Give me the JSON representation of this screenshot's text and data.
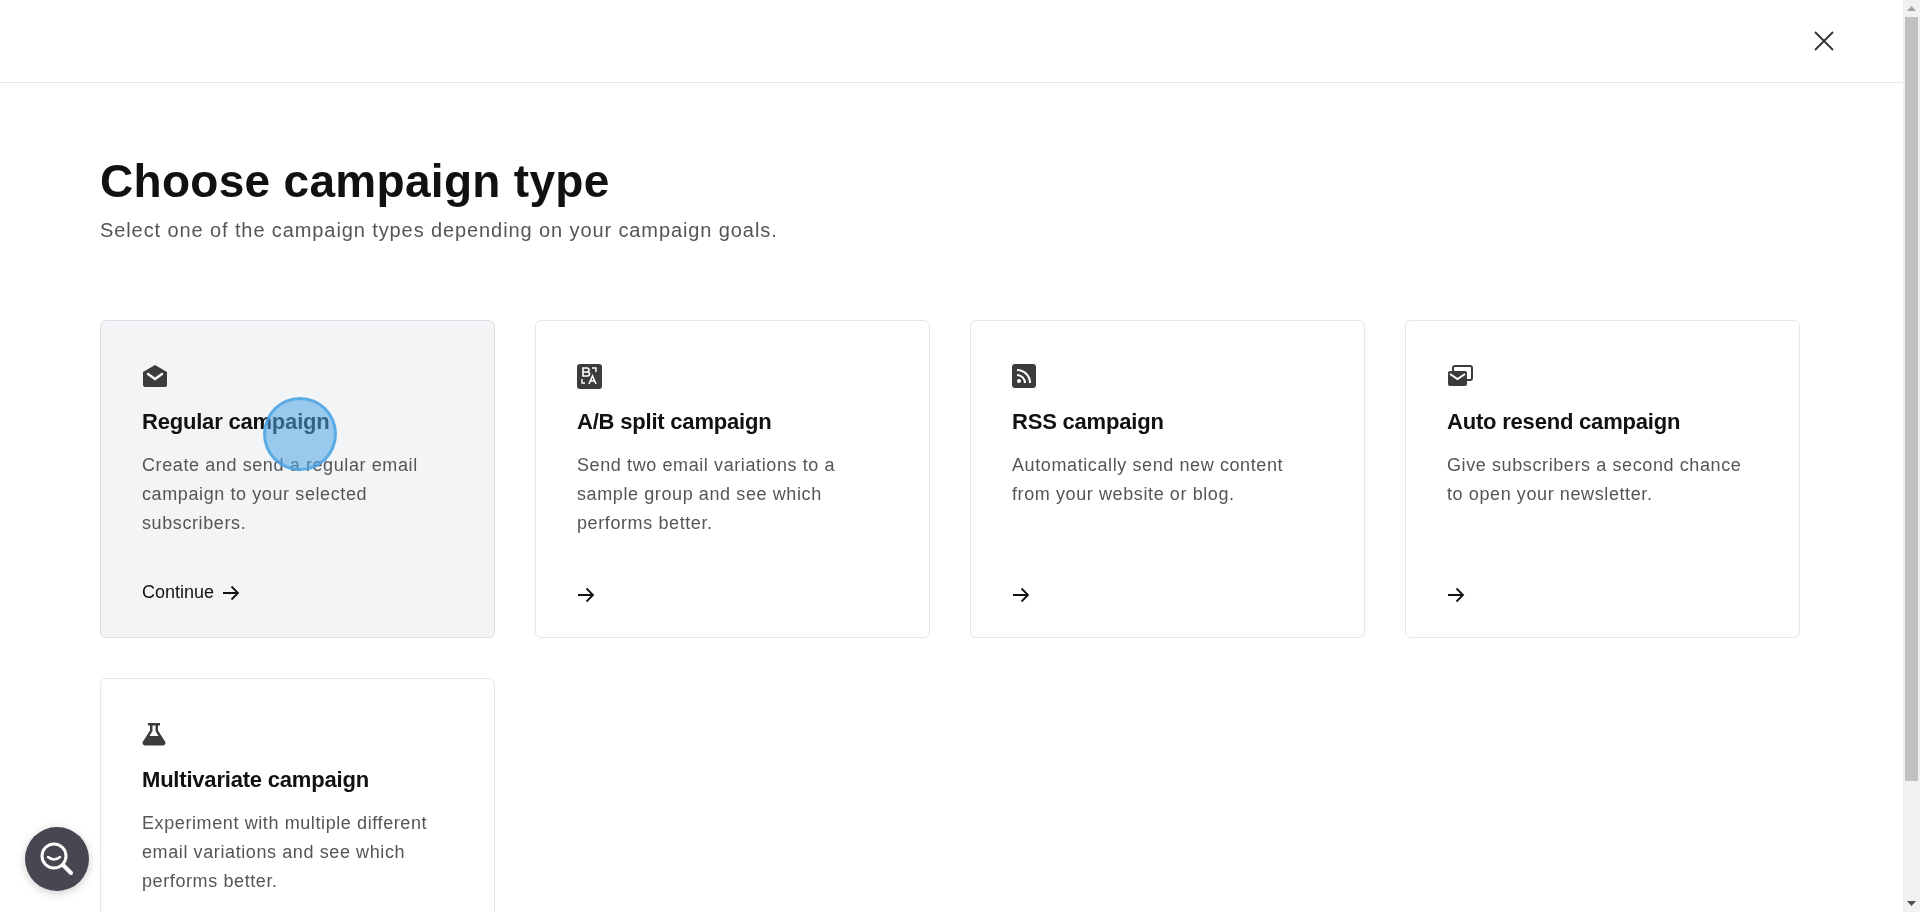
{
  "title": "Choose campaign type",
  "subtitle": "Select one of the campaign types depending on your campaign goals.",
  "cards": [
    {
      "kind": "envelope",
      "title": "Regular campaign",
      "description": "Create and send a regular email campaign to your selected subscribers.",
      "hovered": true,
      "pointer": true,
      "action_label": "Continue"
    },
    {
      "kind": "ab",
      "title": "A/B split campaign",
      "description": "Send two email variations to a sample group and see which performs better.",
      "hovered": false,
      "pointer": false
    },
    {
      "kind": "rss",
      "title": "RSS campaign",
      "description": "Automatically send new content from your website or blog.",
      "hovered": false,
      "pointer": false
    },
    {
      "kind": "resend",
      "title": "Auto resend campaign",
      "description": "Give subscribers a second chance to open your newsletter.",
      "hovered": false,
      "pointer": false
    },
    {
      "kind": "flask",
      "title": "Multivariate campaign",
      "description": "Experiment with multiple different email variations and see which performs better.",
      "hovered": false,
      "pointer": false
    }
  ]
}
